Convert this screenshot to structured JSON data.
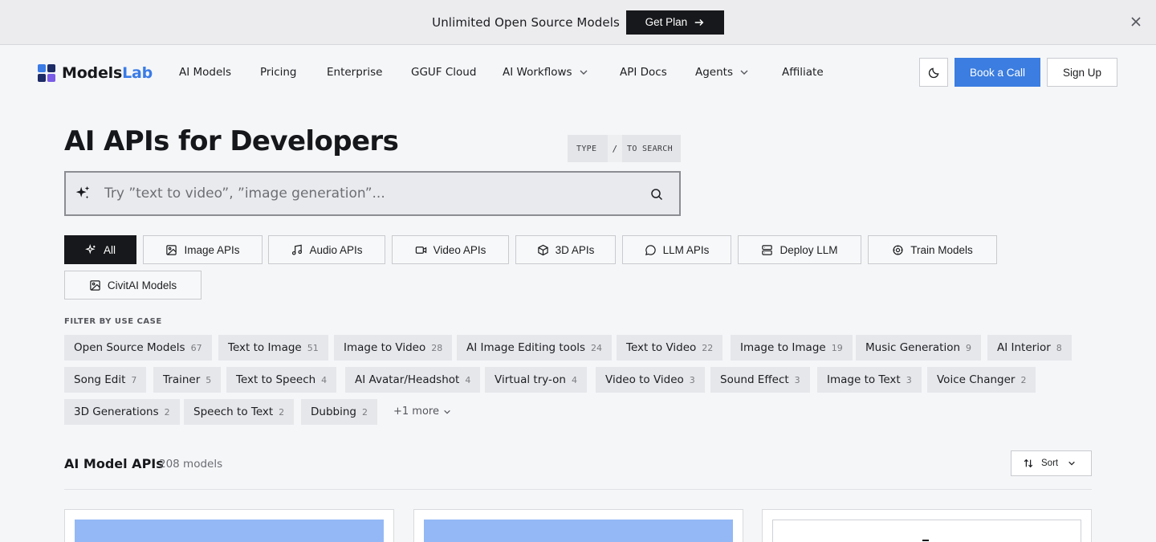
{
  "banner": {
    "text": "Unlimited Open Source Models",
    "cta_label": "Get Plan"
  },
  "nav": {
    "logo_primary": "Models",
    "logo_accent": "Lab",
    "links": [
      {
        "label": "AI Models"
      },
      {
        "label": "Pricing"
      },
      {
        "label": "Enterprise"
      },
      {
        "label": "GGUF Cloud"
      },
      {
        "label": "AI Workflows"
      },
      {
        "label": "API Docs"
      },
      {
        "label": "Agents"
      },
      {
        "label": "Affiliate"
      }
    ],
    "book_call_label": "Book a Call",
    "signup_label": "Sign Up"
  },
  "hero": {
    "title": "AI APIs for Developers",
    "kbd_hint": {
      "type": "TYPE",
      "key": "/",
      "action": "TO SEARCH"
    },
    "search_placeholder": "Try ”text to video”, ”image generation”..."
  },
  "categories": [
    {
      "label": "All",
      "icon": "sparkles-icon",
      "active": true
    },
    {
      "label": "Image APIs",
      "icon": "image-icon"
    },
    {
      "label": "Audio APIs",
      "icon": "music-icon"
    },
    {
      "label": "Video APIs",
      "icon": "video-icon"
    },
    {
      "label": "3D APIs",
      "icon": "cube-icon"
    },
    {
      "label": "LLM APIs",
      "icon": "chat-icon"
    },
    {
      "label": "Deploy LLM",
      "icon": "server-icon"
    },
    {
      "label": "Train Models",
      "icon": "gear-icon"
    },
    {
      "label": "CivitAI Models",
      "icon": "image-icon"
    }
  ],
  "filters": {
    "label": "FILTER BY USE CASE",
    "chips": [
      {
        "label": "Open Source Models",
        "count": "67"
      },
      {
        "label": "Text to Image",
        "count": "51"
      },
      {
        "label": "Image to Video",
        "count": "28"
      },
      {
        "label": "AI Image Editing tools",
        "count": "24"
      },
      {
        "label": "Text to Video",
        "count": "22"
      },
      {
        "label": "Image to Image",
        "count": "19"
      },
      {
        "label": "Music Generation",
        "count": "9"
      },
      {
        "label": "AI Interior",
        "count": "8"
      },
      {
        "label": "Song Edit",
        "count": "7"
      },
      {
        "label": "Trainer",
        "count": "5"
      },
      {
        "label": "Text to Speech",
        "count": "4"
      },
      {
        "label": "AI Avatar/Headshot",
        "count": "4"
      },
      {
        "label": "Virtual try-on",
        "count": "4"
      },
      {
        "label": "Video to Video",
        "count": "3"
      },
      {
        "label": "Sound Effect",
        "count": "3"
      },
      {
        "label": "Image to Text",
        "count": "3"
      },
      {
        "label": "Voice Changer",
        "count": "2"
      },
      {
        "label": "3D Generations",
        "count": "2"
      },
      {
        "label": "Speech to Text",
        "count": "2"
      },
      {
        "label": "Dubbing",
        "count": "2"
      }
    ],
    "more_label": "+1 more"
  },
  "models": {
    "title": "AI Model APIs",
    "count": "208 models",
    "sort_label": "Sort"
  },
  "colors": {
    "accent": "#3b7de0",
    "dark": "#17181b",
    "card_thumb": "#93b8f5"
  }
}
